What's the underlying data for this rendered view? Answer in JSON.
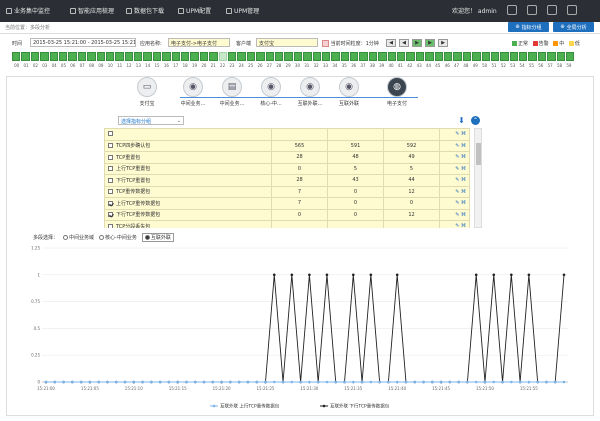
{
  "topbar": {
    "menus": [
      {
        "label": "业务集中监控",
        "icon": "monitor-icon"
      },
      {
        "label": "智能应用梳理",
        "icon": "grid-icon"
      },
      {
        "label": "数据包下载",
        "icon": "download-icon"
      },
      {
        "label": "UPM配置",
        "icon": "wrench-icon"
      },
      {
        "label": "UPM管理",
        "icon": "cloud-icon"
      }
    ],
    "welcome": "欢迎您！ admin"
  },
  "breadcrumb": "当前位置：多段分析",
  "buttons": {
    "metric_group": "指标分组",
    "full_analysis": "全局分析"
  },
  "controls": {
    "time_label": "时间",
    "time_range": "2015-03-25 15:21:00 - 2015-03-25 15:21:59",
    "app_label": "应用名称:",
    "app_value": "电子支付->电子支付",
    "client_label": "客户端",
    "client_value": "支付宝",
    "interval_label": "当前时间粒度：1分钟"
  },
  "status_legend": [
    {
      "label": "正常",
      "color": "#4caf50"
    },
    {
      "label": "告警",
      "color": "#e53935"
    },
    {
      "label": "中",
      "color": "#ff9800"
    },
    {
      "label": "低",
      "color": "#ffd54f"
    }
  ],
  "timeline_labels": [
    "00",
    "01",
    "02",
    "03",
    "04",
    "05",
    "06",
    "07",
    "08",
    "09",
    "10",
    "11",
    "12",
    "13",
    "14",
    "15",
    "16",
    "17",
    "18",
    "19",
    "20",
    "21",
    "22",
    "23",
    "24",
    "25",
    "26",
    "27",
    "28",
    "29",
    "30",
    "31",
    "32",
    "33",
    "34",
    "35",
    "36",
    "37",
    "38",
    "39",
    "40",
    "41",
    "42",
    "43",
    "44",
    "45",
    "46",
    "47",
    "48",
    "49",
    "50",
    "51",
    "52",
    "53",
    "54",
    "55",
    "56",
    "57",
    "58",
    "59"
  ],
  "flow": [
    {
      "label": "支付宝",
      "icon": "laptop-icon"
    },
    {
      "label": "中间业务...",
      "icon": "user-node-icon"
    },
    {
      "label": "中间业务...",
      "icon": "server-icon"
    },
    {
      "label": "核心-中...",
      "icon": "user-node-icon"
    },
    {
      "label": "互联外联...",
      "icon": "user-node-icon"
    },
    {
      "label": "互联外联",
      "icon": "user-node-icon"
    },
    {
      "label": "电子支付",
      "icon": "globe-icon"
    }
  ],
  "dropdown_label": "选择指标分组",
  "table_rows": [
    {
      "name": "",
      "v1": "",
      "v2": "",
      "v3": "",
      "checked": false
    },
    {
      "name": "TCP四步确认包",
      "v1": "565",
      "v2": "591",
      "v3": "592",
      "checked": false
    },
    {
      "name": "TCP重置包",
      "v1": "28",
      "v2": "48",
      "v3": "49",
      "checked": false
    },
    {
      "name": "上行TCP重置包",
      "v1": "0",
      "v2": "5",
      "v3": "5",
      "checked": false
    },
    {
      "name": "下行TCP重置包",
      "v1": "28",
      "v2": "43",
      "v3": "44",
      "checked": false
    },
    {
      "name": "TCP重传数据包",
      "v1": "7",
      "v2": "0",
      "v3": "12",
      "checked": false
    },
    {
      "name": "上行TCP重传数据包",
      "v1": "7",
      "v2": "0",
      "v3": "0",
      "checked": true
    },
    {
      "name": "下行TCP重传数据包",
      "v1": "0",
      "v2": "0",
      "v3": "12",
      "checked": true
    },
    {
      "name": "TCP分段丢失包",
      "v1": "",
      "v2": "",
      "v3": "",
      "checked": false
    }
  ],
  "modes": {
    "label": "多段选择：",
    "options": [
      {
        "label": "中间业务域",
        "on": false
      },
      {
        "label": "核心-中间业务",
        "on": false
      },
      {
        "label": "互联外联",
        "on": true
      }
    ]
  },
  "chart_data": {
    "type": "line",
    "y_ticks": [
      "0",
      "0.25",
      "0.5",
      "0.75",
      "1",
      "1.25"
    ],
    "ylim": [
      0,
      1.25
    ],
    "x_tick_labels": [
      "15:21:00",
      "15:21:05",
      "15:21:10",
      "15:21:15",
      "15:21:20",
      "15:21:25",
      "15:21:30",
      "15:21:35",
      "15:21:40",
      "15:21:45",
      "15:21:50",
      "15:21:55"
    ],
    "series": [
      {
        "name": "互联外联 上行TCP重传数据包",
        "color": "#7cb5ec",
        "values": [
          0,
          0,
          0,
          0,
          0,
          0,
          0,
          0,
          0,
          0,
          0,
          0,
          0,
          0,
          0,
          0,
          0,
          0,
          0,
          0,
          0,
          0,
          0,
          0,
          0,
          0,
          0,
          0,
          0,
          0,
          0,
          0,
          0,
          0,
          0,
          0,
          0,
          0,
          0,
          0,
          0,
          0,
          0,
          0,
          0,
          0,
          0,
          0,
          0,
          0,
          0,
          0,
          0,
          0,
          0,
          0,
          0,
          0,
          0,
          0
        ]
      },
      {
        "name": "互联外联 下行TCP重传数据包",
        "color": "#222222",
        "values": [
          0,
          0,
          0,
          0,
          0,
          0,
          0,
          0,
          0,
          0,
          0,
          0,
          0,
          0,
          0,
          0,
          0,
          0,
          0,
          0,
          0,
          0,
          0,
          0,
          0,
          0,
          1,
          0,
          1,
          0,
          1,
          0,
          1,
          0,
          0,
          1,
          0,
          1,
          0,
          0,
          1,
          0,
          0,
          0,
          0,
          0,
          0,
          0,
          0,
          1,
          0,
          1,
          0,
          1,
          0,
          1,
          0,
          0,
          0,
          1
        ]
      }
    ]
  }
}
